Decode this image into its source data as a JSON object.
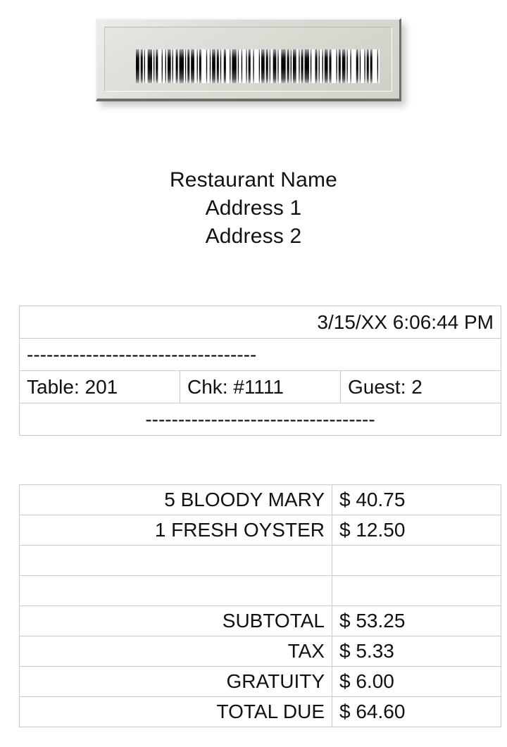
{
  "barcode": {
    "icon": "barcode-icon",
    "plaque_style": "beveled-metal-plaque",
    "bar_pattern": [
      3,
      1,
      2,
      1,
      1,
      2,
      4,
      1,
      1,
      1,
      2,
      3,
      1,
      2,
      1,
      1,
      3,
      1,
      1,
      2,
      2,
      1,
      4,
      1,
      1,
      1,
      2,
      1,
      3,
      2,
      1,
      1,
      2,
      4,
      1,
      2,
      1,
      1,
      3,
      1,
      2,
      1,
      1,
      2,
      2,
      3,
      1,
      1,
      4,
      1,
      1,
      2,
      1,
      3,
      1,
      1,
      2,
      2,
      1,
      4,
      1,
      1,
      3,
      1,
      2,
      1,
      1,
      2,
      3,
      1,
      1,
      2,
      4,
      1,
      2,
      1,
      1,
      1,
      3,
      2,
      1,
      1,
      2,
      1,
      4,
      1,
      1,
      3,
      2,
      1,
      1,
      2,
      1,
      1,
      3,
      1,
      2,
      4,
      1,
      1,
      2,
      1,
      3,
      1,
      1,
      2,
      1,
      4,
      2,
      1,
      1,
      3,
      1,
      1,
      2,
      1,
      2,
      4,
      1,
      1
    ]
  },
  "header": {
    "name": "Restaurant Name",
    "address_line_1": "Address 1",
    "address_line_2": "Address 2"
  },
  "info": {
    "datetime": "3/15/XX 6:06:44 PM",
    "divider_top": "-----------------------------------",
    "divider_bottom": "-----------------------------------",
    "table_label": "Table: 201",
    "check_label": "Chk: #1111",
    "guest_label": "Guest: 2"
  },
  "items": [
    {
      "description": "5 BLOODY MARY",
      "price": "$ 40.75"
    },
    {
      "description": "1 FRESH OYSTER",
      "price": "$ 12.50"
    },
    {
      "description": "",
      "price": ""
    },
    {
      "description": "",
      "price": ""
    }
  ],
  "totals": [
    {
      "label": "SUBTOTAL",
      "amount": "$ 53.25"
    },
    {
      "label": "TAX",
      "amount": "$ 5.33"
    },
    {
      "label": "GRATUITY",
      "amount": "$ 6.00"
    },
    {
      "label": "TOTAL DUE",
      "amount": "$ 64.60"
    }
  ],
  "colors": {
    "background": "#ffffff",
    "text": "#111111",
    "grid_line": "#c9c9c9",
    "plaque_face": "#dcdcd6",
    "plaque_bevel_dark": "#6e6e66",
    "barcode_bar": "#000000"
  }
}
